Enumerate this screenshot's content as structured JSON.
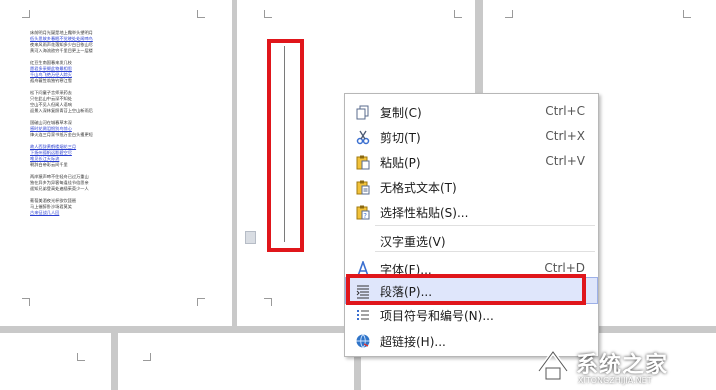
{
  "document": {
    "page1_lines": [
      {
        "text": "床前明月光疑是地上霜举头望明月",
        "blue": false
      },
      {
        "text": "低头思故乡春眠不觉晓处处闻啼鸟",
        "blue": true
      },
      {
        "text": "夜来风雨声花落知多少白日依山尽",
        "blue": false
      },
      {
        "text": "黄河入海流欲穷千里目更上一层楼",
        "blue": false
      },
      {
        "text": "",
        "blue": false
      },
      {
        "text": "红豆生南国春来发几枝",
        "blue": false
      },
      {
        "text": "愿君多采撷此物最相思",
        "blue": true
      },
      {
        "text": "千山鸟飞绝万径人踪灭",
        "blue": true
      },
      {
        "text": "孤舟蓑笠翁独钓寒江雪",
        "blue": false
      },
      {
        "text": "",
        "blue": false
      },
      {
        "text": "松下问童子言师采药去",
        "blue": false
      },
      {
        "text": "只在此山中云深不知处",
        "blue": false
      },
      {
        "text": "空山不见人但闻人语响",
        "blue": false
      },
      {
        "text": "返景入深林复照青苔上空山新雨后",
        "blue": false
      },
      {
        "text": "",
        "blue": false
      },
      {
        "text": "国破山河在城春草木深",
        "blue": false
      },
      {
        "text": "感时花溅泪恨别鸟惊心",
        "blue": true
      },
      {
        "text": "烽火连三月家书抵万金白头搔更短",
        "blue": false
      },
      {
        "text": "",
        "blue": false
      },
      {
        "text": "故人西辞黄鹤楼烟花三月",
        "blue": true
      },
      {
        "text": "下扬州孤帆远影碧空尽",
        "blue": true
      },
      {
        "text": "唯见长江天际流",
        "blue": true
      },
      {
        "text": "朝辞白帝彩云间千里",
        "blue": false
      },
      {
        "text": "",
        "blue": false
      },
      {
        "text": "两岸猿声啼不住轻舟已过万重山",
        "blue": false
      },
      {
        "text": "独在异乡为异客每逢佳节倍思亲",
        "blue": false
      },
      {
        "text": "遥知兄弟登高处遍插茱萸少一人",
        "blue": false
      },
      {
        "text": "",
        "blue": false
      },
      {
        "text": "葡萄美酒夜光杯欲饮琵琶",
        "blue": false
      },
      {
        "text": "马上催醉卧沙场君莫笑",
        "blue": false
      },
      {
        "text": "古来征战几人回",
        "blue": true
      }
    ]
  },
  "context_menu": {
    "items": [
      {
        "name": "copy",
        "label": "复制(C)",
        "shortcut": "Ctrl+C",
        "icon": "copy-icon"
      },
      {
        "name": "cut",
        "label": "剪切(T)",
        "shortcut": "Ctrl+X",
        "icon": "scissors-icon"
      },
      {
        "name": "paste",
        "label": "粘贴(P)",
        "shortcut": "Ctrl+V",
        "icon": "paste-icon"
      },
      {
        "name": "paste-plain",
        "label": "无格式文本(T)",
        "shortcut": "",
        "icon": "paste-plain-icon"
      },
      {
        "name": "paste-special",
        "label": "选择性粘贴(S)...",
        "shortcut": "",
        "icon": "paste-special-icon"
      },
      {
        "name": "hanzi-reselect",
        "label": "汉字重选(V)",
        "shortcut": "",
        "icon": ""
      },
      {
        "name": "font",
        "label": "字体(F)...",
        "shortcut": "Ctrl+D",
        "icon": "font-icon"
      },
      {
        "name": "paragraph",
        "label": "段落(P)...",
        "shortcut": "",
        "icon": "paragraph-icon"
      },
      {
        "name": "bullets-numbering",
        "label": "项目符号和编号(N)...",
        "shortcut": "",
        "icon": "list-icon"
      },
      {
        "name": "hyperlink",
        "label": "超链接(H)...",
        "shortcut": "",
        "icon": "globe-link-icon"
      }
    ],
    "selected_item": "paragraph"
  },
  "watermark": {
    "title": "系统之家",
    "url": "XITONGZHIJIA.NET"
  },
  "colors": {
    "highlight_red": "#e0161b",
    "selected_bg": "#dfe6fb",
    "link_blue": "#2a3fd0"
  }
}
